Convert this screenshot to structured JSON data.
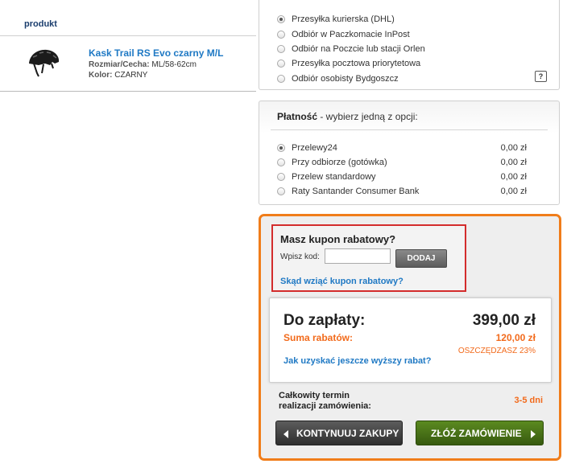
{
  "cart": {
    "column_header": "produkt",
    "product": {
      "name": "Kask Trail RS Evo czarny M/L",
      "size_label": "Rozmiar/Cecha:",
      "size_value": "ML/58-62cm",
      "color_label": "Kolor:",
      "color_value": "CZARNY"
    }
  },
  "shipping": {
    "options": [
      {
        "label": "Przesyłka kurierska (DHL)",
        "selected": true
      },
      {
        "label": "Odbiór w Paczkomacie InPost",
        "selected": false
      },
      {
        "label": "Odbiór na Poczcie lub stacji Orlen",
        "selected": false
      },
      {
        "label": "Przesyłka pocztowa priorytetowa",
        "selected": false
      },
      {
        "label": "Odbiór osobisty Bydgoszcz",
        "selected": false
      }
    ],
    "help_label": "?"
  },
  "payment": {
    "title_bold": "Płatność",
    "title_rest": " - wybierz jedną z opcji:",
    "options": [
      {
        "label": "Przelewy24",
        "price": "0,00 zł",
        "selected": true
      },
      {
        "label": "Przy odbiorze (gotówka)",
        "price": "0,00 zł",
        "selected": false
      },
      {
        "label": "Przelew standardowy",
        "price": "0,00 zł",
        "selected": false
      },
      {
        "label": "Raty Santander Consumer Bank",
        "price": "0,00 zł",
        "selected": false
      }
    ]
  },
  "coupon": {
    "title": "Masz kupon rabatowy?",
    "input_label": "Wpisz kod:",
    "input_value": "",
    "button": "DODAJ",
    "link": "Skąd wziąć kupon rabatowy?"
  },
  "total": {
    "label": "Do zapłaty:",
    "value": "399,00 zł",
    "discount_label": "Suma rabatów:",
    "discount_value": "120,00 zł",
    "savings": "OSZCZĘDZASZ 23%",
    "more_link": "Jak uzyskać jeszcze wyższy rabat?"
  },
  "delivery": {
    "label_line1": "Całkowity termin",
    "label_line2": "realizacji zamówienia:",
    "value": "3-5 dni"
  },
  "buttons": {
    "continue": "KONTYNUUJ ZAKUPY",
    "order": "ZŁÓŻ ZAMÓWIENIE"
  },
  "colors": {
    "accent_orange": "#f07d1a",
    "link_blue": "#1f79c4",
    "order_green": "#4a7a18",
    "coupon_highlight": "#d32c2c"
  }
}
